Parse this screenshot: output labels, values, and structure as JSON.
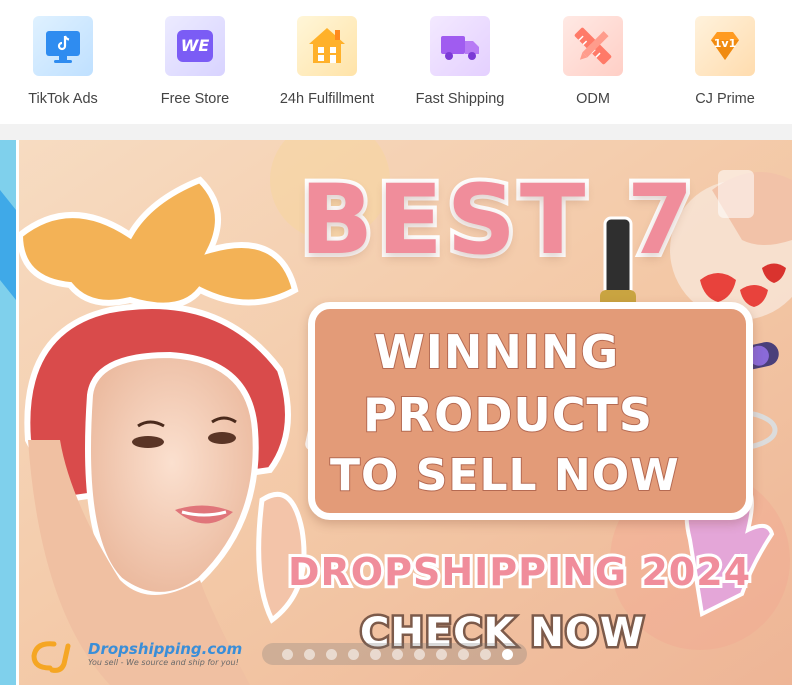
{
  "quick_nav": [
    {
      "label": "TikTok Ads",
      "icon": "tiktok-monitor-icon",
      "tile_color": "#d6ecff"
    },
    {
      "label": "Free Store",
      "icon": "we-store-icon",
      "tile_color": "#e4e0ff"
    },
    {
      "label": "24h Fulfillment",
      "icon": "house-icon",
      "tile_color": "#fff0c8"
    },
    {
      "label": "Fast Shipping",
      "icon": "delivery-truck-icon",
      "tile_color": "#efe2ff"
    },
    {
      "label": "ODM",
      "icon": "ruler-pencil-icon",
      "tile_color": "#ffe0dc"
    },
    {
      "label": "CJ Prime",
      "icon": "prime-badge-icon",
      "tile_color": "#ffeacc"
    }
  ],
  "tile_texts": {
    "free_store_glyph": "WE",
    "prime_badge_text": "1v1"
  },
  "banner": {
    "headline": "BEST 7",
    "tagline_lines": [
      "WINNING",
      "PRODUCTS",
      "TO SELL NOW"
    ],
    "subheadline": "DROPSHIPPING 2024",
    "cta": "CHECK NOW",
    "logo_brand": "Dropshipping.com",
    "logo_slogan": "You sell - We source and ship for you!",
    "slide_count": 11,
    "active_slide": 11
  },
  "colors": {
    "headline_pink": "#f08d9b",
    "tagline_box": "#e39b78",
    "brand_blue": "#3a8ed8",
    "logo_orange": "#f5a623"
  }
}
